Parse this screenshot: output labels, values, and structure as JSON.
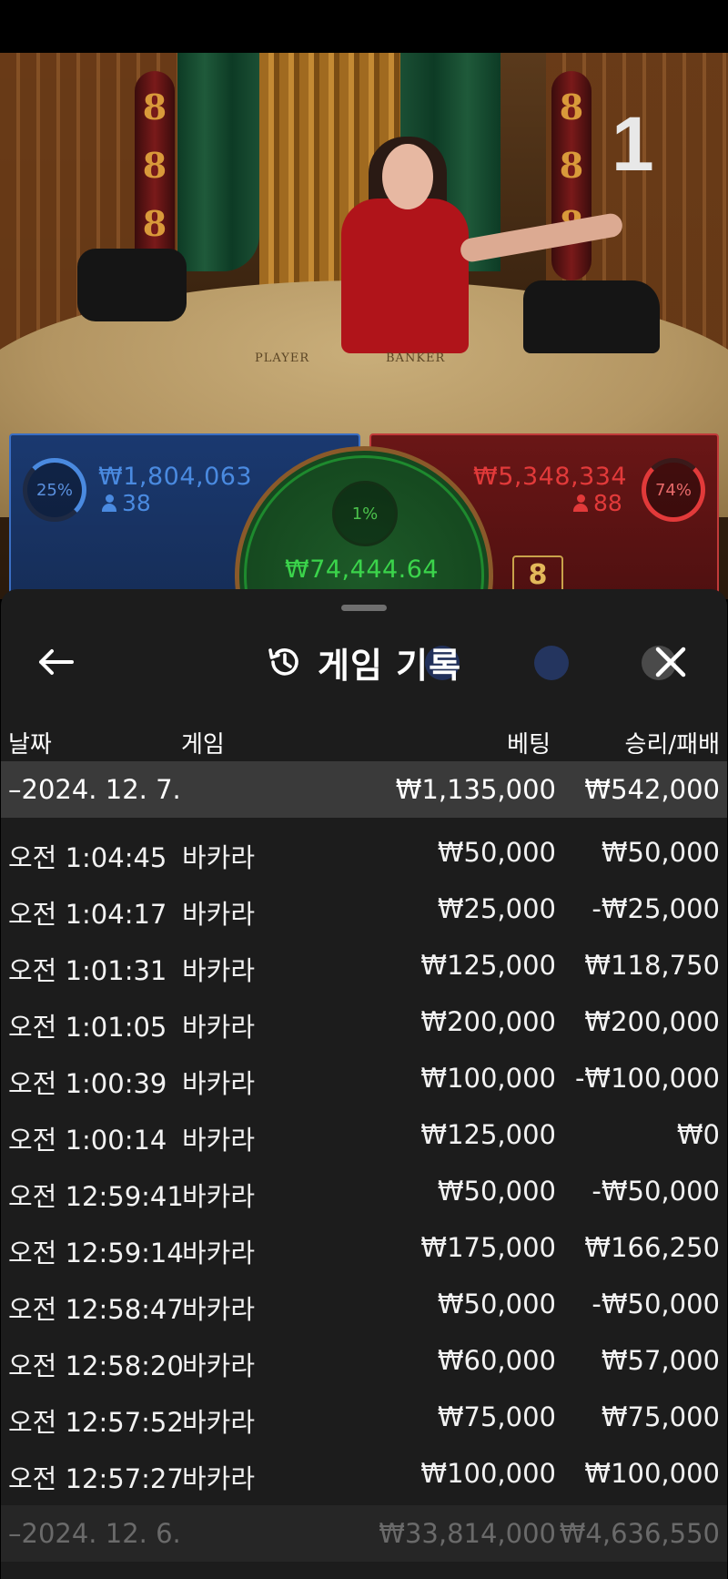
{
  "video": {
    "round_number": "1",
    "table_labels": {
      "player": "PLAYER",
      "banker": "BANKER"
    },
    "column_glyph": "8"
  },
  "betting": {
    "player": {
      "percent": "25%",
      "amount": "₩1,804,063",
      "players": "38",
      "color": "#4a8ae0"
    },
    "tie": {
      "percent": "1%",
      "amount": "₩74,444.64",
      "color": "#3bd44b"
    },
    "banker": {
      "percent": "74%",
      "amount": "₩5,348,334",
      "players": "88",
      "color": "#e23a3a"
    },
    "card_value": "8"
  },
  "history": {
    "title": "게임 기록",
    "icons": {
      "back": "arrow-left-icon",
      "title": "history-icon",
      "close": "close-icon"
    },
    "columns": {
      "date": "날짜",
      "game": "게임",
      "bet": "베팅",
      "win_loss": "승리/패배"
    },
    "groups": [
      {
        "date": "–2024. 12. 7.",
        "bet_total": "₩1,135,000",
        "win_total": "₩542,000",
        "rows": [
          {
            "time": "오전 1:04:45",
            "game": "바카라",
            "bet": "₩50,000",
            "win": "₩50,000"
          },
          {
            "time": "오전 1:04:17",
            "game": "바카라",
            "bet": "₩25,000",
            "win": "-₩25,000"
          },
          {
            "time": "오전 1:01:31",
            "game": "바카라",
            "bet": "₩125,000",
            "win": "₩118,750"
          },
          {
            "time": "오전 1:01:05",
            "game": "바카라",
            "bet": "₩200,000",
            "win": "₩200,000"
          },
          {
            "time": "오전 1:00:39",
            "game": "바카라",
            "bet": "₩100,000",
            "win": "-₩100,000"
          },
          {
            "time": "오전 1:00:14",
            "game": "바카라",
            "bet": "₩125,000",
            "win": "₩0"
          },
          {
            "time": "오전 12:59:41",
            "game": "바카라",
            "bet": "₩50,000",
            "win": "-₩50,000"
          },
          {
            "time": "오전 12:59:14",
            "game": "바카라",
            "bet": "₩175,000",
            "win": "₩166,250"
          },
          {
            "time": "오전 12:58:47",
            "game": "바카라",
            "bet": "₩50,000",
            "win": "-₩50,000"
          },
          {
            "time": "오전 12:58:20",
            "game": "바카라",
            "bet": "₩60,000",
            "win": "₩57,000"
          },
          {
            "time": "오전 12:57:52",
            "game": "바카라",
            "bet": "₩75,000",
            "win": "₩75,000"
          },
          {
            "time": "오전 12:57:27",
            "game": "바카라",
            "bet": "₩100,000",
            "win": "₩100,000"
          }
        ]
      },
      {
        "date": "–2024. 12. 6.",
        "bet_total": "₩33,814,000",
        "win_total": "₩4,636,550",
        "rows": []
      }
    ]
  }
}
